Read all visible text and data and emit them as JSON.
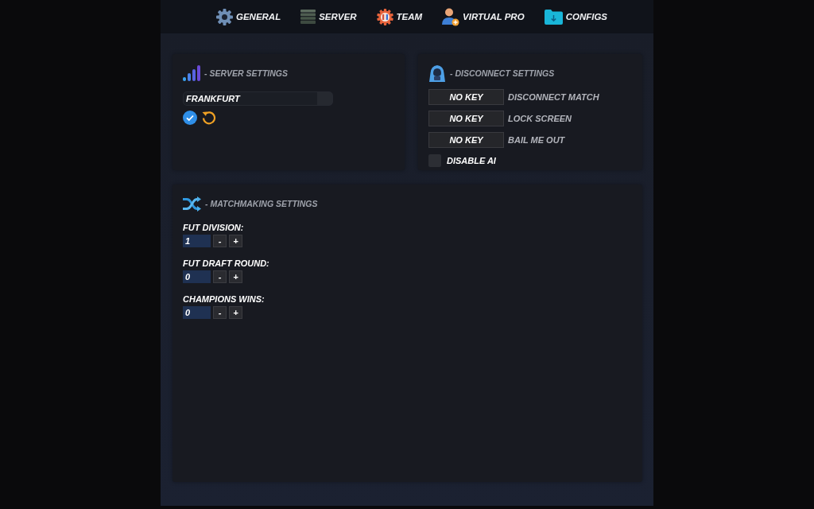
{
  "nav": [
    {
      "label": "GENERAL"
    },
    {
      "label": "SERVER"
    },
    {
      "label": "TEAM"
    },
    {
      "label": "VIRTUAL PRO"
    },
    {
      "label": "CONFIGS"
    }
  ],
  "server_settings": {
    "title": "- SERVER SETTINGS",
    "server": "FRANKFURT"
  },
  "disconnect_settings": {
    "title": "- DISCONNECT SETTINGS",
    "keybinds": [
      {
        "key": "NO KEY",
        "action": "DISCONNECT MATCH"
      },
      {
        "key": "NO KEY",
        "action": "LOCK SCREEN"
      },
      {
        "key": "NO KEY",
        "action": "BAIL ME OUT"
      }
    ],
    "disable_ai": {
      "label": "DISABLE AI",
      "checked": false
    }
  },
  "matchmaking_settings": {
    "title": "- MATCHMAKING SETTINGS",
    "fields": [
      {
        "label": "FUT DIVISION:",
        "value": "1",
        "decrement": "-",
        "increment": "+"
      },
      {
        "label": "FUT DRAFT ROUND:",
        "value": "0",
        "decrement": "-",
        "increment": "+"
      },
      {
        "label": "CHAMPIONS WINS:",
        "value": "0",
        "decrement": "-",
        "increment": "+"
      }
    ]
  }
}
